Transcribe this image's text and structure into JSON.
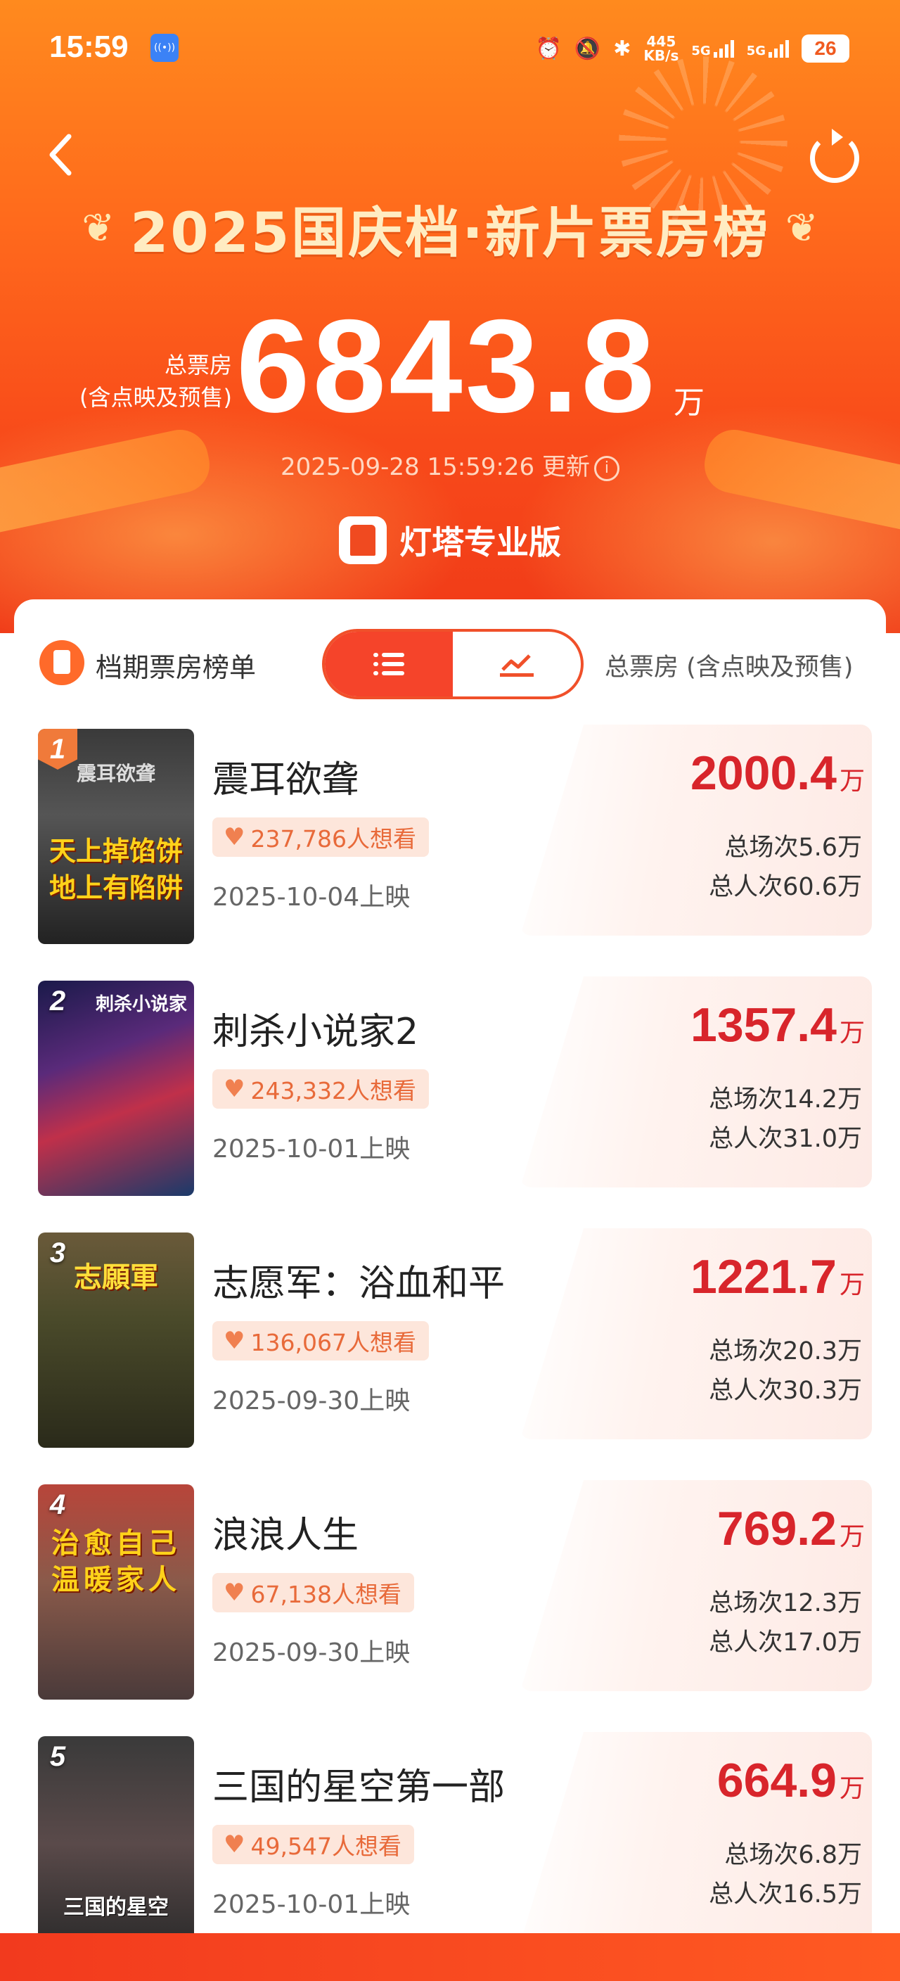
{
  "status": {
    "time": "15:59",
    "speed_value": "445",
    "speed_unit": "KB/s",
    "net1": "5G",
    "net2": "5G",
    "battery": "26"
  },
  "header": {
    "title": "2025国庆档·新片票房榜",
    "total_label_line1": "总票房",
    "total_label_line2": "(含点映及预售)",
    "total_value": "6843.8",
    "total_unit": "万",
    "updated": "2025-09-28 15:59:26 更新",
    "brand": "灯塔专业版"
  },
  "list_header": {
    "section_title": "档期票房榜单",
    "metric_label": "总票房 (含点映及预售)"
  },
  "movies": [
    {
      "rank": "1",
      "title": "震耳欲聋",
      "want": "237,786人想看",
      "release": "2025-10-04上映",
      "box": "2000.4",
      "unit": "万",
      "shows": "总场次5.6万",
      "admissions": "总人次60.6万",
      "poster_top": "震耳欲聋",
      "poster_line1": "天上掉馅饼",
      "poster_line2": "地上有陷阱"
    },
    {
      "rank": "2",
      "title": "刺杀小说家2",
      "want": "243,332人想看",
      "release": "2025-10-01上映",
      "box": "1357.4",
      "unit": "万",
      "shows": "总场次14.2万",
      "admissions": "总人次31.0万",
      "poster_top": "刺杀小说家"
    },
    {
      "rank": "3",
      "title": "志愿军：浴血和平",
      "want": "136,067人想看",
      "release": "2025-09-30上映",
      "box": "1221.7",
      "unit": "万",
      "shows": "总场次20.3万",
      "admissions": "总人次30.3万",
      "poster_top": "志願軍"
    },
    {
      "rank": "4",
      "title": "浪浪人生",
      "want": "67,138人想看",
      "release": "2025-09-30上映",
      "box": "769.2",
      "unit": "万",
      "shows": "总场次12.3万",
      "admissions": "总人次17.0万",
      "poster_line1": "治愈自己",
      "poster_line2": "温暖家人"
    },
    {
      "rank": "5",
      "title": "三国的星空第一部",
      "want": "49,547人想看",
      "release": "2025-10-01上映",
      "box": "664.9",
      "unit": "万",
      "shows": "总场次6.8万",
      "admissions": "总人次16.5万",
      "poster_top": "三国的星空"
    }
  ],
  "colors": {
    "header_orange": "#ff6a1c",
    "accent_red": "#d8252b",
    "pill_bg": "#fde6db"
  }
}
